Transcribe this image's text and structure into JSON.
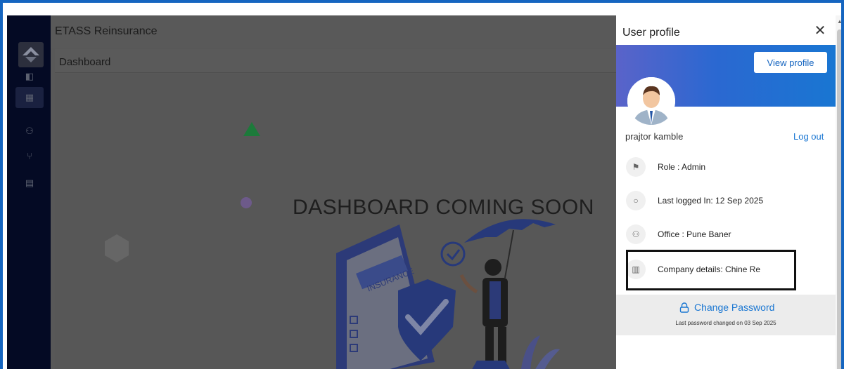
{
  "app": {
    "title": "ETASS Reinsurance",
    "page_title": "Dashboard",
    "coming_soon": "DASHBOARD COMING SOON",
    "illustration_text": "INSURANCE"
  },
  "sidebar": {
    "items": [
      {
        "icon": "panel-icon"
      },
      {
        "icon": "dashboard-icon",
        "active": true
      },
      {
        "icon": "org-chart-icon"
      },
      {
        "icon": "branch-icon"
      },
      {
        "icon": "document-icon"
      }
    ]
  },
  "drawer": {
    "title": "User profile",
    "close_label": "✕",
    "view_profile_label": "View profile",
    "username": "prajtor kamble",
    "logout_label": "Log out",
    "info": [
      {
        "icon": "role-icon",
        "text": "Role : Admin"
      },
      {
        "icon": "clock-icon",
        "text": "Last logged In: 12 Sep 2025"
      },
      {
        "icon": "office-icon",
        "text": "Office : Pune Baner"
      },
      {
        "icon": "building-icon",
        "text": "Company details: Chine Re"
      }
    ],
    "change_password_label": "Change Password",
    "password_note": "Last password changed on 03 Sep 2025"
  },
  "colors": {
    "frame": "#1565c0",
    "accent": "#1976d2",
    "sidebar_bg": "#040a24",
    "overlay_bg": "#585858"
  }
}
